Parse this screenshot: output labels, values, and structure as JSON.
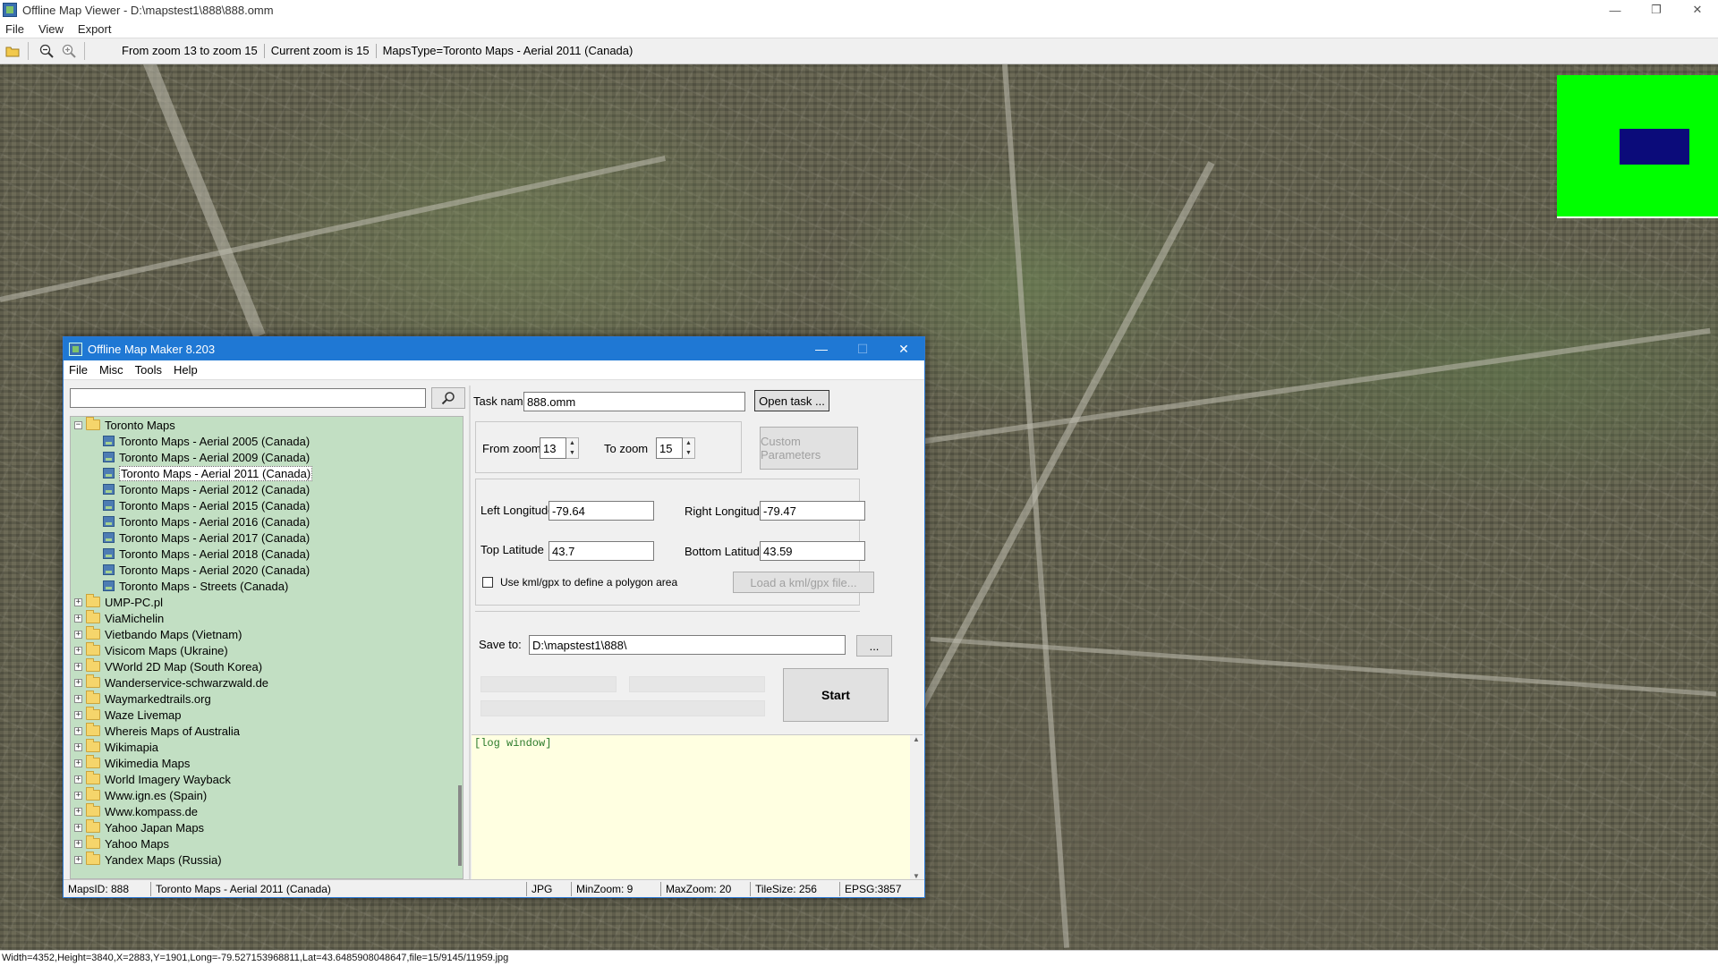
{
  "window": {
    "title": "Offline Map Viewer - D:\\mapstest1\\888\\888.omm",
    "controls": {
      "minimize": "—",
      "restore": "❐",
      "close": "✕"
    }
  },
  "menu": [
    "File",
    "View",
    "Export"
  ],
  "toolbar": {
    "zoom_range": "From zoom 13 to zoom 15",
    "current_zoom": "Current zoom is 15",
    "maps_type": "MapsType=Toronto Maps - Aerial 2011 (Canada)"
  },
  "status_bar": "Width=4352,Height=3840,X=2883,Y=1901,Long=-79.527153968811,Lat=43.6485908048647,file=15/9145/11959.jpg",
  "dialog": {
    "title": "Offline Map Maker 8.203",
    "menu": [
      "File",
      "Misc",
      "Tools",
      "Help"
    ],
    "search": {
      "value": ""
    },
    "tree": {
      "root": "Toronto Maps",
      "children": [
        "Toronto Maps - Aerial 2005 (Canada)",
        "Toronto Maps - Aerial 2009 (Canada)",
        "Toronto Maps - Aerial 2011 (Canada)",
        "Toronto Maps - Aerial 2012 (Canada)",
        "Toronto Maps - Aerial 2015 (Canada)",
        "Toronto Maps - Aerial 2016 (Canada)",
        "Toronto Maps - Aerial 2017 (Canada)",
        "Toronto Maps - Aerial 2018 (Canada)",
        "Toronto Maps - Aerial 2020 (Canada)",
        "Toronto Maps - Streets (Canada)"
      ],
      "selected_index": 2,
      "folders": [
        "UMP-PC.pl",
        "ViaMichelin",
        "Vietbando Maps (Vietnam)",
        "Visicom Maps (Ukraine)",
        "VWorld 2D Map (South Korea)",
        "Wanderservice-schwarzwald.de",
        "Waymarkedtrails.org",
        "Waze Livemap",
        "Whereis Maps of Australia",
        "Wikimapia",
        "Wikimedia Maps",
        "World Imagery Wayback",
        "Www.ign.es (Spain)",
        "Www.kompass.de",
        "Yahoo Japan Maps",
        "Yahoo Maps",
        "Yandex Maps (Russia)"
      ]
    },
    "task_name_label": "Task name",
    "task_name_value": "888.omm",
    "open_task_label": "Open task ...",
    "from_zoom_label": "From zoom",
    "from_zoom_value": "13",
    "to_zoom_label": "To zoom",
    "to_zoom_value": "15",
    "custom_params_label": "Custom Parameters",
    "left_lon_label": "Left Longitude",
    "left_lon_value": "-79.64",
    "right_lon_label": "Right Longitude",
    "right_lon_value": "-79.47",
    "top_lat_label": "Top Latitude",
    "top_lat_value": "43.7",
    "bottom_lat_label": "Bottom Latitude",
    "bottom_lat_value": "43.59",
    "kml_checkbox_label": "Use kml/gpx to define a polygon area",
    "load_kml_label": "Load a kml/gpx file...",
    "save_to_label": "Save to:",
    "save_to_value": "D:\\mapstest1\\888\\",
    "browse_label": "...",
    "start_label": "Start",
    "log_text": "[log window]",
    "status": {
      "maps_id": "MapsID: 888",
      "map_name": "Toronto Maps - Aerial 2011 (Canada)",
      "format": "JPG",
      "min_zoom": "MinZoom: 9",
      "max_zoom": "MaxZoom: 20",
      "tile_size": "TileSize: 256",
      "epsg": "EPSG:3857"
    }
  }
}
